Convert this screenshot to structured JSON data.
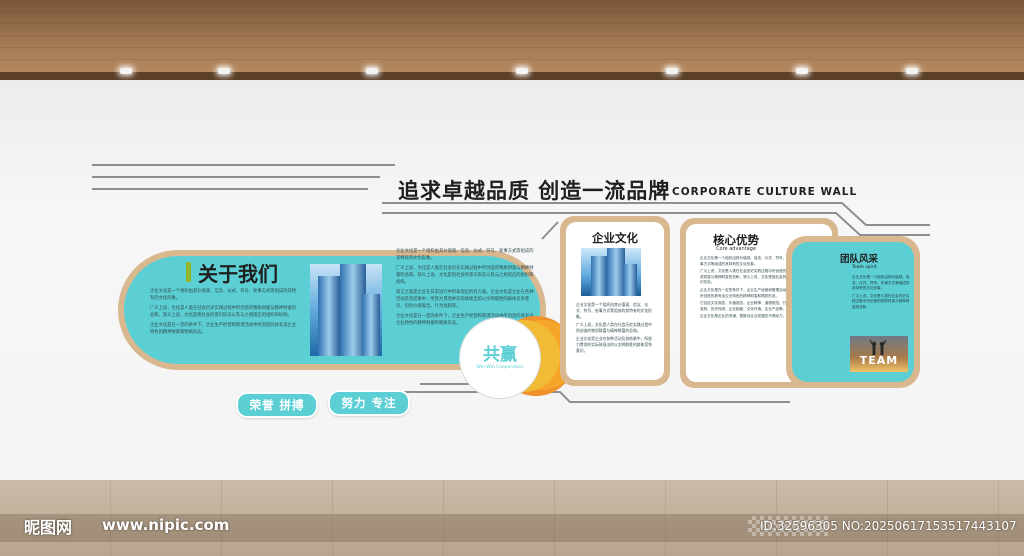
{
  "heading": {
    "slogan": "追求卓越品质 创造一流品牌",
    "subtitle_en": "CORPORATE CULTURE WALL"
  },
  "about": {
    "title": "关于我们",
    "paragraphs": [
      "企业文化是一个组织由其价值观、信念、仪式、符号、处事方式等组成的其特有的文化形象。",
      "广义上说，文化是人类在社会历史实践过程中所创造的物质财富与精神财富的总和，狭义上说，文化是指社会的意识形态以及与之相适应的组织和机构。",
      "简言之就是企业在日常运行中所表现出的各方面。企业文化是企业在各种活动及其结果中，所努力贯彻并实际体现出的以文明取胜的群体竞争意识，包括价值观念、行为准则等。",
      "企业文化是在一定的条件下，企业生产经营和管理活动中所创造的具有该企业特色的精神财富和物质形态。"
    ]
  },
  "badges": [
    "荣誉  拼搏",
    "努力  专注"
  ],
  "win_win": {
    "title": "共赢",
    "subtitle": "Win-Win Cooperation"
  },
  "culture": {
    "title": "企业文化",
    "paragraphs": [
      "企业文化是一个组织由其价值观、信念、仪式、符号、处事方式等组成的其特有的文化形象。",
      "广义上说，文化是人类在社会历史实践过程中所创造的物质财富与精神财富的总和。",
      "企业文化是企业在各种活动及其结果中，所努力贯彻并实际体现出的以文明取胜的群体竞争意识。"
    ]
  },
  "advantage": {
    "title": "核心优势",
    "subtitle": "Core advantage",
    "paragraphs": [
      "企业文化是一个组织由其价值观、信念、仪式、符号、处事方式等组成的其特有的文化形象。",
      "广义上说，文化是人类在社会历史实践过程中所创造的物质财富与精神财富的总和，狭义上说，文化是指社会的意识形态。",
      "企业文化是在一定的条件下，企业生产经营和管理活动中所创造的具有该企业特色的精神财富和物质形态。",
      "它包括文化观念、价值观念、企业精神、道德规范、行为准则、历史传统、企业制度、文化环境、企业产品等。",
      "企业文化是企业的灵魂，是推动企业发展的不竭动力。"
    ]
  },
  "team": {
    "title": "团队风采",
    "subtitle": "Team spirit",
    "paragraphs": [
      "企业文化是一个组织由其价值观、信念、仪式、符号、处事方式等组成的其特有的文化形象。",
      "广义上说，文化是人类在社会历史实践过程中所创造的物质财富与精神财富的总和。"
    ],
    "photo_word": "TEAM"
  },
  "watermark": {
    "logo": "昵图网",
    "url": "www.nipic.com",
    "id_text": "ID:32596305 NO:20250617153517443107"
  },
  "colors": {
    "teal": "#5ccfd5",
    "tan": "#d9b78f",
    "green_bar": "#93b52f",
    "orange": "#f0912e"
  }
}
